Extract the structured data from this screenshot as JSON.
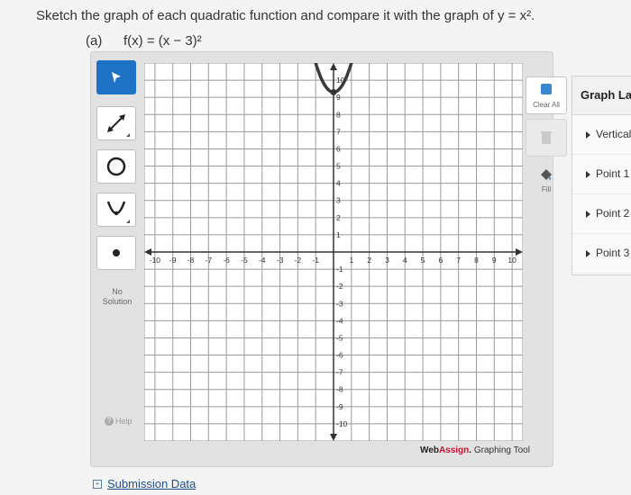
{
  "question": {
    "prompt": "Sketch the graph of each quadratic function and compare it with the graph of y = x².",
    "part_label": "(a)",
    "function": "f(x) = (x − 3)²"
  },
  "toolbar": {
    "tools": [
      {
        "name": "pointer-tool",
        "icon": "arrow-pointer-icon",
        "active": true
      },
      {
        "name": "line-tool",
        "icon": "line-icon"
      },
      {
        "name": "circle-tool",
        "icon": "circle-icon"
      },
      {
        "name": "parabola-tool",
        "icon": "parabola-icon"
      },
      {
        "name": "point-tool",
        "icon": "point-icon"
      }
    ],
    "no_solution_label": "No Solution",
    "help_label": "Help"
  },
  "graph": {
    "x_ticks": [
      "-10",
      "-9",
      "-8",
      "-7",
      "-6",
      "-5",
      "-4",
      "-3",
      "-2",
      "-1",
      "1",
      "2",
      "3",
      "4",
      "5",
      "6",
      "7",
      "8",
      "9",
      "10"
    ],
    "y_ticks": [
      "10",
      "9",
      "8",
      "7",
      "6",
      "5",
      "4",
      "3",
      "2",
      "1",
      "-1",
      "-2",
      "-3",
      "-4",
      "-5",
      "-6",
      "-7",
      "-8",
      "-9",
      "-10"
    ],
    "xlim": [
      -10.6,
      10.6
    ],
    "ylim": [
      -11,
      11
    ],
    "curve": {
      "type": "parabola",
      "vertex": [
        0,
        9.3
      ],
      "through": [
        [
          -1,
          11
        ],
        [
          1,
          11
        ]
      ],
      "color": "#3a3a3a"
    },
    "vertex_point": [
      0,
      9.3
    ]
  },
  "right_tools": {
    "clear_all_label": "Clear All",
    "fill_label": "Fill"
  },
  "brand": {
    "web": "Web",
    "assign": "Assign",
    "suffix": "Graphing Tool"
  },
  "layers_panel": {
    "title": "Graph Layers",
    "items": [
      "Vertical",
      "Point 1",
      "Point 2",
      "Point 3"
    ]
  },
  "submission_data": {
    "label": "Submission Data"
  },
  "colors": {
    "accent": "#1f73c6",
    "brand_red": "#c8102e",
    "grid": "#9a9a9a"
  }
}
